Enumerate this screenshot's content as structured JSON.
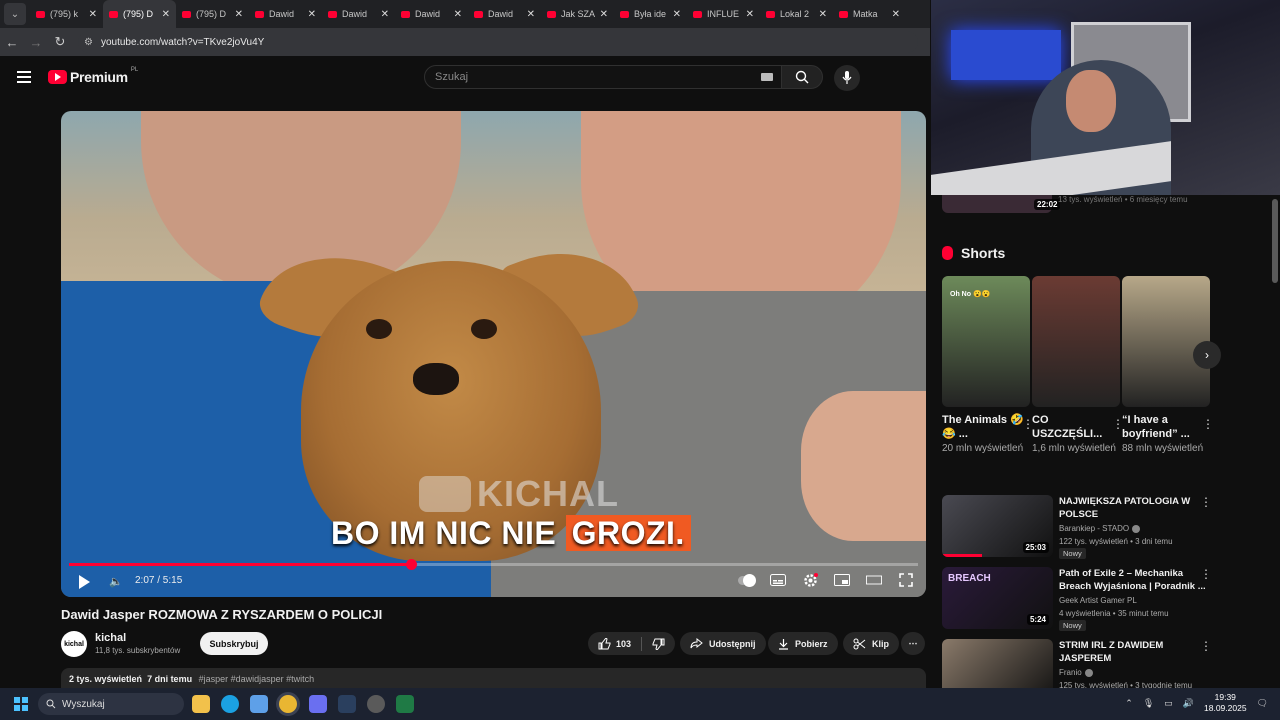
{
  "browser": {
    "tabs": [
      {
        "title": "(795) k",
        "active": false
      },
      {
        "title": "(795) D",
        "active": true
      },
      {
        "title": "(795) D",
        "active": false
      },
      {
        "title": "Dawid",
        "active": false
      },
      {
        "title": "Dawid",
        "active": false
      },
      {
        "title": "Dawid",
        "active": false
      },
      {
        "title": "Dawid",
        "active": false
      },
      {
        "title": "Jak SZA",
        "active": false
      },
      {
        "title": "Była ide",
        "active": false
      },
      {
        "title": "INFLUE",
        "active": false
      },
      {
        "title": "Lokal 2",
        "active": false
      },
      {
        "title": "Matka",
        "active": false
      }
    ],
    "url": "youtube.com/watch?v=TKve2joVu4Y"
  },
  "header": {
    "logo_text": "Premium",
    "country": "PL",
    "search_placeholder": "Szukaj"
  },
  "player": {
    "watermark": "KICHAL",
    "caption_plain": "BO IM NIC NIE",
    "caption_highlight": "GROZI.",
    "time": "2:07 / 5:15",
    "progress": 0.403
  },
  "video": {
    "title": "Dawid Jasper ROZMOWA Z RYSZARDEM O POLICJI",
    "channel_avatar_text": "kichal",
    "channel": "kichal",
    "subscribers": "11,8 tys. subskrybentów",
    "subscribe_label": "Subskrybuj",
    "likes": "103",
    "share_label": "Udostępnij",
    "download_label": "Pobierz",
    "clip_label": "Klip",
    "desc_views": "2 tys. wyświetleń",
    "desc_date": "7 dni temu",
    "desc_tags": "#jasper #dawidjasper #twitch"
  },
  "sidebar": {
    "prev_item": {
      "duration": "22:02",
      "meta": "13 tys. wyświetleń • 6 miesięcy temu"
    },
    "shorts_title": "Shorts",
    "shorts": [
      {
        "title": "The Animals 🤣😂 ...",
        "views": "20 mln wyświetleń",
        "overlay": "Oh No 😮😮",
        "color": "#6d8a5a"
      },
      {
        "title": "CO USZCZĘŚLI...",
        "views": "1,6 mln wyświetleń",
        "overlay": "",
        "color": "#6b3b33"
      },
      {
        "title": "“I have a boyfriend” ...",
        "views": "88 mln wyświetleń",
        "overlay": "",
        "color": "#b7a889"
      }
    ],
    "videos": [
      {
        "title": "NAJWIĘKSZA PATOLOGIA W POLSCE",
        "channel": "Barankiep - STADO",
        "verified": true,
        "meta": "122 tys. wyświetleń • 3 dni temu",
        "badge": "Nowy",
        "duration": "25:03",
        "color": "#4a4a52",
        "watched": true
      },
      {
        "title": "Path of Exile 2 – Mechanika Breach Wyjaśniona | Poradnik ...",
        "channel": "Geek Artist Gamer PL",
        "verified": false,
        "meta": "4 wyświetlenia • 35 minut temu",
        "badge": "Nowy",
        "duration": "5:24",
        "color": "#2a1a3a",
        "thumb_text": "BREACH",
        "watched": false
      },
      {
        "title": "STRIM IRL Z DAWIDEM JASPEREM",
        "channel": "Franio",
        "verified": true,
        "meta": "125 tys. wyświetleń • 3 tygodnie temu",
        "badge": "",
        "duration": "",
        "color": "#8a7a6a",
        "watched": false
      }
    ]
  },
  "taskbar": {
    "search_placeholder": "Wyszukaj",
    "time": "19:39",
    "date": "18.09.2025"
  }
}
